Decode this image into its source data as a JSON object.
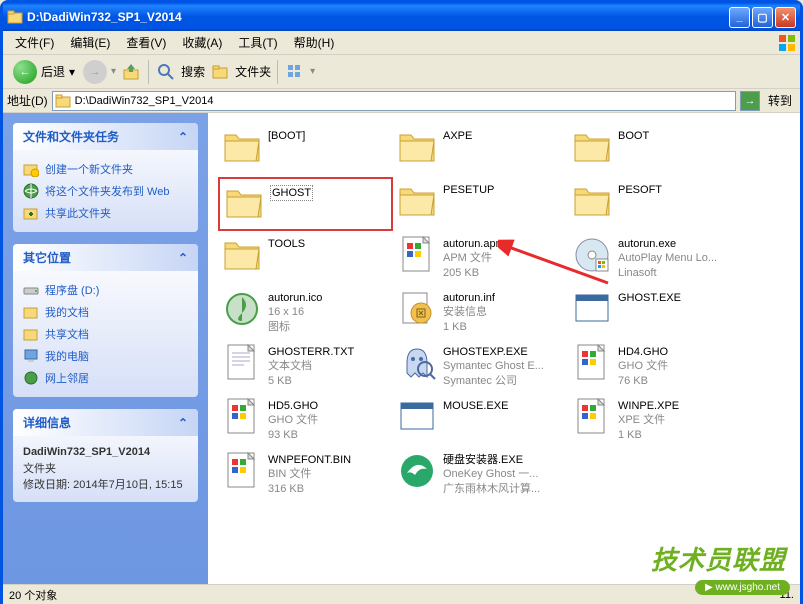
{
  "window": {
    "title": "D:\\DadiWin732_SP1_V2014"
  },
  "menu": {
    "file": "文件(F)",
    "edit": "编辑(E)",
    "view": "查看(V)",
    "favorites": "收藏(A)",
    "tools": "工具(T)",
    "help": "帮助(H)"
  },
  "toolbar": {
    "back": "后退",
    "search": "搜索",
    "folders": "文件夹"
  },
  "addressbar": {
    "label": "地址(D)",
    "value": "D:\\DadiWin732_SP1_V2014",
    "go": "转到"
  },
  "tasks": {
    "panel1": {
      "title": "文件和文件夹任务",
      "items": [
        "创建一个新文件夹",
        "将这个文件夹发布到 Web",
        "共享此文件夹"
      ]
    },
    "panel2": {
      "title": "其它位置",
      "items": [
        "程序盘 (D:)",
        "我的文档",
        "共享文档",
        "我的电脑",
        "网上邻居"
      ]
    },
    "panel3": {
      "title": "详细信息",
      "name": "DadiWin732_SP1_V2014",
      "type": "文件夹",
      "modified": "修改日期: 2014年7月10日, 15:15"
    }
  },
  "files": [
    {
      "name": "[BOOT]",
      "type": "folder"
    },
    {
      "name": "AXPE",
      "type": "folder"
    },
    {
      "name": "BOOT",
      "type": "folder"
    },
    {
      "name": "GHOST",
      "type": "folder",
      "hl": true,
      "box": true
    },
    {
      "name": "PESETUP",
      "type": "folder"
    },
    {
      "name": "PESOFT",
      "type": "folder"
    },
    {
      "name": "TOOLS",
      "type": "folder"
    },
    {
      "name": "autorun.apm",
      "meta1": "APM 文件",
      "meta2": "205 KB",
      "type": "apm"
    },
    {
      "name": "autorun.exe",
      "meta1": "AutoPlay Menu Lo...",
      "meta2": "Linasoft",
      "type": "cd"
    },
    {
      "name": "autorun.ico",
      "meta1": "16 x 16",
      "meta2": "图标",
      "type": "ico"
    },
    {
      "name": "autorun.inf",
      "meta1": "安装信息",
      "meta2": "1 KB",
      "type": "inf"
    },
    {
      "name": "GHOST.EXE",
      "meta1": "",
      "meta2": "",
      "type": "app"
    },
    {
      "name": "GHOSTERR.TXT",
      "meta1": "文本文档",
      "meta2": "5 KB",
      "type": "txt"
    },
    {
      "name": "GHOSTEXP.EXE",
      "meta1": "Symantec Ghost E...",
      "meta2": "Symantec 公司",
      "type": "ghostexp"
    },
    {
      "name": "HD4.GHO",
      "meta1": "GHO 文件",
      "meta2": "76 KB",
      "type": "gho"
    },
    {
      "name": "HD5.GHO",
      "meta1": "GHO 文件",
      "meta2": "93 KB",
      "type": "gho"
    },
    {
      "name": "MOUSE.EXE",
      "meta1": "",
      "meta2": "",
      "type": "app"
    },
    {
      "name": "WINPE.XPE",
      "meta1": "XPE 文件",
      "meta2": "1 KB",
      "type": "xpe"
    },
    {
      "name": "WNPEFONT.BIN",
      "meta1": "BIN 文件",
      "meta2": "316 KB",
      "type": "bin"
    },
    {
      "name": "硬盘安装器.EXE",
      "meta1": "OneKey Ghost 一...",
      "meta2": "广东雨林木风计算...",
      "type": "onekey"
    }
  ],
  "statusbar": {
    "left": "20 个对象",
    "right": "11."
  },
  "watermark": {
    "text": "技术员联盟",
    "url": "www.jsgho.net"
  }
}
